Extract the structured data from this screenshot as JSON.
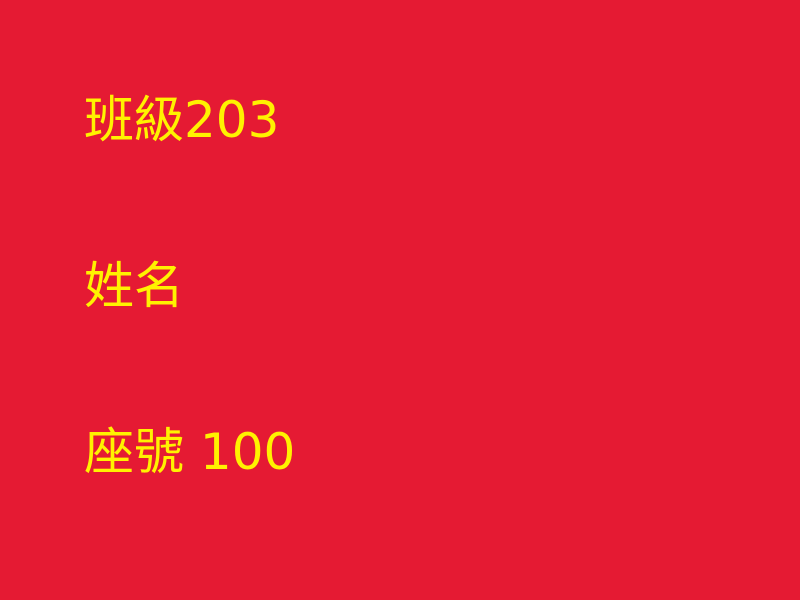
{
  "screen": {
    "background_color": "#E51A33",
    "text_color": "#FFF200"
  },
  "lines": {
    "class_text": "班級203",
    "name_text": "姓名",
    "seat_text": "座號 100"
  }
}
